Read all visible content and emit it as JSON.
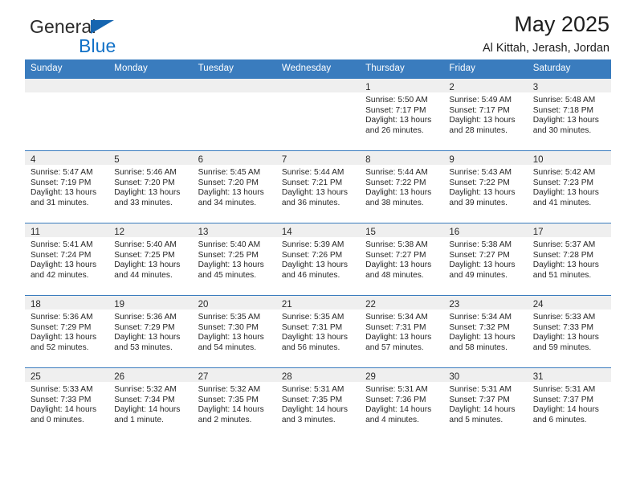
{
  "brand": {
    "line1": "General",
    "line2": "Blue",
    "flag_icon": "blue-triangle-flag-icon",
    "accent_color": "#1171c7"
  },
  "header": {
    "title": "May 2025",
    "subtitle": "Al Kittah, Jerash, Jordan"
  },
  "theme": {
    "header_blue": "#3a7cbe",
    "daynum_gray": "#efefef",
    "text": "#262626"
  },
  "calendar": {
    "weekday_headers": [
      "Sunday",
      "Monday",
      "Tuesday",
      "Wednesday",
      "Thursday",
      "Friday",
      "Saturday"
    ],
    "weeks": [
      [
        {
          "day": "",
          "lines": []
        },
        {
          "day": "",
          "lines": []
        },
        {
          "day": "",
          "lines": []
        },
        {
          "day": "",
          "lines": []
        },
        {
          "day": "1",
          "lines": [
            "Sunrise: 5:50 AM",
            "Sunset: 7:17 PM",
            "Daylight: 13 hours",
            "and 26 minutes."
          ]
        },
        {
          "day": "2",
          "lines": [
            "Sunrise: 5:49 AM",
            "Sunset: 7:17 PM",
            "Daylight: 13 hours",
            "and 28 minutes."
          ]
        },
        {
          "day": "3",
          "lines": [
            "Sunrise: 5:48 AM",
            "Sunset: 7:18 PM",
            "Daylight: 13 hours",
            "and 30 minutes."
          ]
        }
      ],
      [
        {
          "day": "4",
          "lines": [
            "Sunrise: 5:47 AM",
            "Sunset: 7:19 PM",
            "Daylight: 13 hours",
            "and 31 minutes."
          ]
        },
        {
          "day": "5",
          "lines": [
            "Sunrise: 5:46 AM",
            "Sunset: 7:20 PM",
            "Daylight: 13 hours",
            "and 33 minutes."
          ]
        },
        {
          "day": "6",
          "lines": [
            "Sunrise: 5:45 AM",
            "Sunset: 7:20 PM",
            "Daylight: 13 hours",
            "and 34 minutes."
          ]
        },
        {
          "day": "7",
          "lines": [
            "Sunrise: 5:44 AM",
            "Sunset: 7:21 PM",
            "Daylight: 13 hours",
            "and 36 minutes."
          ]
        },
        {
          "day": "8",
          "lines": [
            "Sunrise: 5:44 AM",
            "Sunset: 7:22 PM",
            "Daylight: 13 hours",
            "and 38 minutes."
          ]
        },
        {
          "day": "9",
          "lines": [
            "Sunrise: 5:43 AM",
            "Sunset: 7:22 PM",
            "Daylight: 13 hours",
            "and 39 minutes."
          ]
        },
        {
          "day": "10",
          "lines": [
            "Sunrise: 5:42 AM",
            "Sunset: 7:23 PM",
            "Daylight: 13 hours",
            "and 41 minutes."
          ]
        }
      ],
      [
        {
          "day": "11",
          "lines": [
            "Sunrise: 5:41 AM",
            "Sunset: 7:24 PM",
            "Daylight: 13 hours",
            "and 42 minutes."
          ]
        },
        {
          "day": "12",
          "lines": [
            "Sunrise: 5:40 AM",
            "Sunset: 7:25 PM",
            "Daylight: 13 hours",
            "and 44 minutes."
          ]
        },
        {
          "day": "13",
          "lines": [
            "Sunrise: 5:40 AM",
            "Sunset: 7:25 PM",
            "Daylight: 13 hours",
            "and 45 minutes."
          ]
        },
        {
          "day": "14",
          "lines": [
            "Sunrise: 5:39 AM",
            "Sunset: 7:26 PM",
            "Daylight: 13 hours",
            "and 46 minutes."
          ]
        },
        {
          "day": "15",
          "lines": [
            "Sunrise: 5:38 AM",
            "Sunset: 7:27 PM",
            "Daylight: 13 hours",
            "and 48 minutes."
          ]
        },
        {
          "day": "16",
          "lines": [
            "Sunrise: 5:38 AM",
            "Sunset: 7:27 PM",
            "Daylight: 13 hours",
            "and 49 minutes."
          ]
        },
        {
          "day": "17",
          "lines": [
            "Sunrise: 5:37 AM",
            "Sunset: 7:28 PM",
            "Daylight: 13 hours",
            "and 51 minutes."
          ]
        }
      ],
      [
        {
          "day": "18",
          "lines": [
            "Sunrise: 5:36 AM",
            "Sunset: 7:29 PM",
            "Daylight: 13 hours",
            "and 52 minutes."
          ]
        },
        {
          "day": "19",
          "lines": [
            "Sunrise: 5:36 AM",
            "Sunset: 7:29 PM",
            "Daylight: 13 hours",
            "and 53 minutes."
          ]
        },
        {
          "day": "20",
          "lines": [
            "Sunrise: 5:35 AM",
            "Sunset: 7:30 PM",
            "Daylight: 13 hours",
            "and 54 minutes."
          ]
        },
        {
          "day": "21",
          "lines": [
            "Sunrise: 5:35 AM",
            "Sunset: 7:31 PM",
            "Daylight: 13 hours",
            "and 56 minutes."
          ]
        },
        {
          "day": "22",
          "lines": [
            "Sunrise: 5:34 AM",
            "Sunset: 7:31 PM",
            "Daylight: 13 hours",
            "and 57 minutes."
          ]
        },
        {
          "day": "23",
          "lines": [
            "Sunrise: 5:34 AM",
            "Sunset: 7:32 PM",
            "Daylight: 13 hours",
            "and 58 minutes."
          ]
        },
        {
          "day": "24",
          "lines": [
            "Sunrise: 5:33 AM",
            "Sunset: 7:33 PM",
            "Daylight: 13 hours",
            "and 59 minutes."
          ]
        }
      ],
      [
        {
          "day": "25",
          "lines": [
            "Sunrise: 5:33 AM",
            "Sunset: 7:33 PM",
            "Daylight: 14 hours",
            "and 0 minutes."
          ]
        },
        {
          "day": "26",
          "lines": [
            "Sunrise: 5:32 AM",
            "Sunset: 7:34 PM",
            "Daylight: 14 hours",
            "and 1 minute."
          ]
        },
        {
          "day": "27",
          "lines": [
            "Sunrise: 5:32 AM",
            "Sunset: 7:35 PM",
            "Daylight: 14 hours",
            "and 2 minutes."
          ]
        },
        {
          "day": "28",
          "lines": [
            "Sunrise: 5:31 AM",
            "Sunset: 7:35 PM",
            "Daylight: 14 hours",
            "and 3 minutes."
          ]
        },
        {
          "day": "29",
          "lines": [
            "Sunrise: 5:31 AM",
            "Sunset: 7:36 PM",
            "Daylight: 14 hours",
            "and 4 minutes."
          ]
        },
        {
          "day": "30",
          "lines": [
            "Sunrise: 5:31 AM",
            "Sunset: 7:37 PM",
            "Daylight: 14 hours",
            "and 5 minutes."
          ]
        },
        {
          "day": "31",
          "lines": [
            "Sunrise: 5:31 AM",
            "Sunset: 7:37 PM",
            "Daylight: 14 hours",
            "and 6 minutes."
          ]
        }
      ]
    ]
  }
}
